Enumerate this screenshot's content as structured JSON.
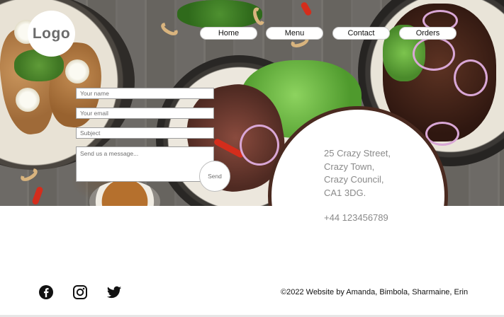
{
  "logo": {
    "text": "Logo"
  },
  "nav": {
    "home": "Home",
    "menu": "Menu",
    "contact": "Contact",
    "orders": "Orders"
  },
  "form": {
    "name_placeholder": "Your name",
    "email_placeholder": "Your email",
    "subject_placeholder": "Subject",
    "message_placeholder": "Send us a message...",
    "send_label": "Send"
  },
  "address": {
    "line1": "25 Crazy Street,",
    "line2": "Crazy Town,",
    "line3": "Crazy Council,",
    "line4": "CA1 3DG.",
    "phone": "+44 123456789"
  },
  "footer": {
    "social": [
      "facebook-icon",
      "instagram-icon",
      "twitter-icon"
    ],
    "copyright": "©2022 Website by Amanda, Bimbola, Sharmaine, Erin"
  },
  "colors": {
    "accent_brown": "#4a2a20",
    "text_gray": "#8a8a8a"
  }
}
